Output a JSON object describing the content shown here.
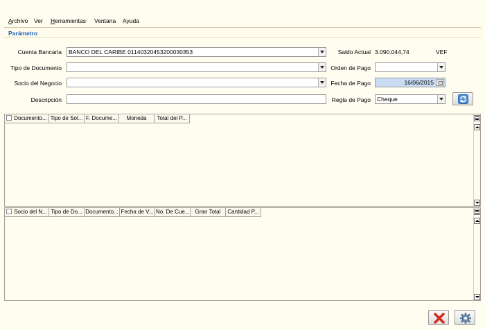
{
  "menu": {
    "items": [
      {
        "label": "Archivo",
        "underline": "A"
      },
      {
        "label": "Ver",
        "underline": ""
      },
      {
        "label": "Herramientas",
        "underline": "H"
      },
      {
        "label": "Ventana",
        "underline": ""
      },
      {
        "label": "Ayuda",
        "underline": ""
      }
    ]
  },
  "section": {
    "title": "Parámetro"
  },
  "form": {
    "cuenta_bancaria": {
      "label": "Cuenta Bancaria",
      "value": "BANCO DEL CARIBE 01140320453200030353"
    },
    "tipo_documento": {
      "label": "Tipo de Documento",
      "value": ""
    },
    "socio_negocio": {
      "label": "Socio del Negocio",
      "value": ""
    },
    "descripcion": {
      "label": "Descripción",
      "value": ""
    },
    "saldo_actual": {
      "label": "Saldo Actual",
      "value": "3.090.044,74",
      "currency": "VEF"
    },
    "orden_pago": {
      "label": "Orden de Pago",
      "value": ""
    },
    "fecha_pago": {
      "label": "Fecha de Pago",
      "value": "16/06/2015"
    },
    "regla_pago": {
      "label": "Regla de Pago",
      "value": "Cheque"
    }
  },
  "table_top": {
    "columns": [
      "Documento...",
      "Tipo de Sol...",
      "F. Docume...",
      "Moneda",
      "Total del P..."
    ]
  },
  "table_bottom": {
    "columns": [
      "Socio del N...",
      "Tipo de Do...",
      "Documento...",
      "Fecha de V...",
      "No. De Cue...",
      "Gran Total",
      "Cantidad P..."
    ]
  },
  "icons": {
    "refresh": "refresh-icon",
    "cancel": "cancel-x-icon",
    "process": "process-gear-icon"
  },
  "colors": {
    "accent": "#1f5fb5",
    "cancel_red": "#d42a1c",
    "date_bg": "#c9dcf3"
  }
}
